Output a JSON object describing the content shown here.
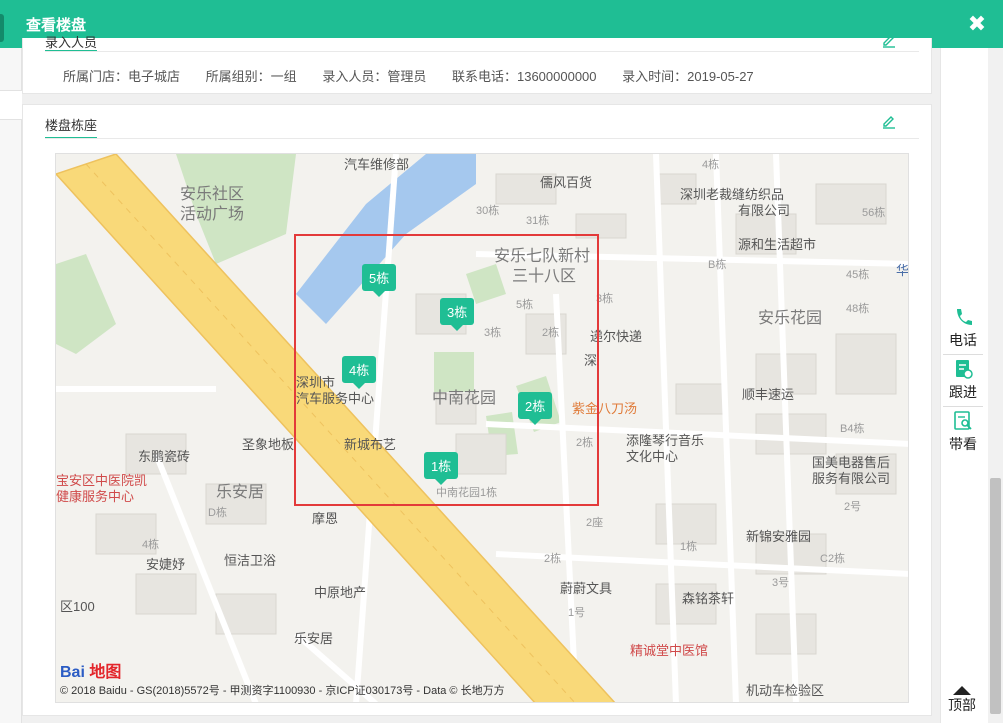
{
  "modal": {
    "title": "查看楼盘",
    "close_glyph": "✖"
  },
  "recorder_section": {
    "title": "录入人员",
    "fields": [
      {
        "label": "所属门店：",
        "value": "电子城店"
      },
      {
        "label": "所属组别：",
        "value": "一组"
      },
      {
        "label": "录入人员：",
        "value": "管理员"
      },
      {
        "label": "联系电话：",
        "value": "13600000000"
      },
      {
        "label": "录入时间：",
        "value": "2019-05-27"
      }
    ]
  },
  "building_section": {
    "title": "楼盘栋座"
  },
  "map": {
    "markers": [
      "5栋",
      "3栋",
      "4栋",
      "2栋",
      "1栋"
    ],
    "labels": {
      "l1": "汽车维修部",
      "l2": "儒风百货",
      "l3": "安乐社区",
      "l4": "活动广场",
      "l5": "安乐七队新村",
      "l6": "三十八区",
      "l7": "深圳老裁缝纺织品",
      "l8": "有限公司",
      "l9": "源和生活超市",
      "l10": "安乐花园",
      "l11": "递尔快递",
      "l12": "深",
      "l13": "深圳市",
      "l14": "汽车服务中心",
      "l15": "中南花园",
      "l16": "紫金八刀汤",
      "l17": "顺丰速运",
      "l18": "新城布艺",
      "l19": "添隆琴行音乐",
      "l20": "文化中心",
      "l21": "国美电器售后",
      "l22": "服务有限公司",
      "l23": "东鹏瓷砖",
      "l24": "圣象地板",
      "l25": "宝安区中医院凯",
      "l26": "健康服务中心",
      "l27": "乐安居",
      "l28": "中南花园1栋",
      "l29": "摩恩",
      "l30": "新锦安雅园",
      "l31": "安婕妤",
      "l32": "恒洁卫浴",
      "l33": "蔚蔚文具",
      "l34": "森铭茶轩",
      "l35": "中原地产",
      "l36": "乐安居",
      "l37": "精诚堂中医馆",
      "l38": "机动车检验区",
      "l39": "华",
      "l40": "区100",
      "b1": "4栋",
      "b2": "30栋",
      "b3": "31栋",
      "b4": "3栋",
      "b5": "5栋",
      "b6": "2栋",
      "b7": "3栋",
      "b8": "56栋",
      "b9": "45栋",
      "b10": "48栋",
      "b11": "B栋",
      "b12": "B4栋",
      "b13": "C2栋",
      "b14": "2栋",
      "b15": "2号",
      "b16": "3号",
      "b17": "1号",
      "b18": "2座",
      "b19": "D栋",
      "b20": "4栋",
      "b21": "2栋",
      "b22": "1栋"
    },
    "logo_text": "Bai",
    "logo_text_2": "地图",
    "copyright": "© 2018 Baidu - GS(2018)5572号 - 甲测资字1100930 - 京ICP证030173号 - Data © 长地万方"
  },
  "rail": {
    "phone": "电话",
    "follow": "跟进",
    "view": "带看",
    "top": "顶部"
  },
  "colors": {
    "primary": "#1fbe94",
    "highlight": "#e33a3a"
  }
}
